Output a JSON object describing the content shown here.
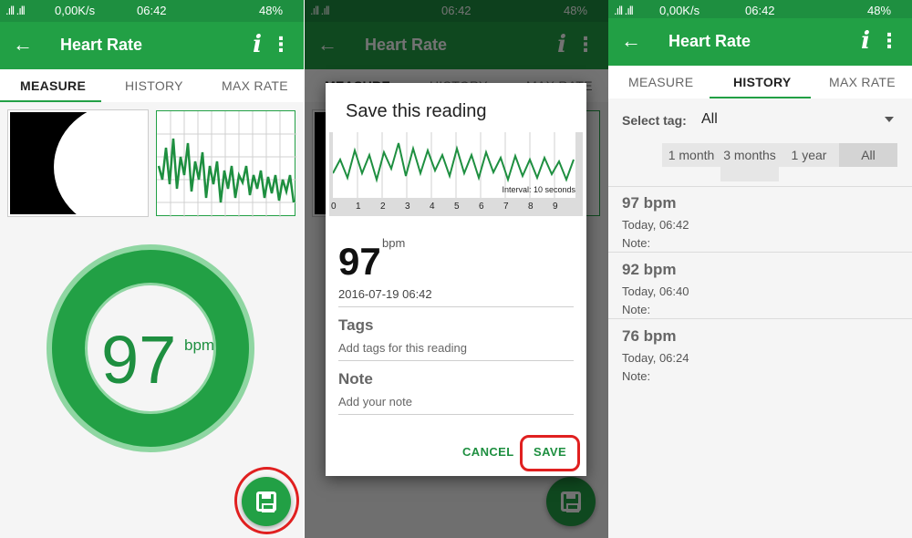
{
  "status": {
    "speed": "0,00K/s",
    "time": "06:42",
    "battery": "48%"
  },
  "app": {
    "title": "Heart Rate",
    "info_glyph": "i",
    "back_icon": "arrow-left-icon",
    "menu_icon": "more-vert-icon"
  },
  "tabs": [
    "MEASURE",
    "HISTORY",
    "MAX RATE"
  ],
  "measure": {
    "value": "97",
    "unit": "bpm"
  },
  "dialog": {
    "title": "Save this reading",
    "interval": "Interval: 10 seconds",
    "ticks": [
      "0",
      "1",
      "2",
      "3",
      "4",
      "5",
      "6",
      "7",
      "8",
      "9"
    ],
    "value": "97",
    "unit": "bpm",
    "datetime": "2016-07-19 06:42",
    "tags_label": "Tags",
    "tags_placeholder": "Add tags for this reading",
    "note_label": "Note",
    "note_placeholder": "Add your note",
    "cancel": "CANCEL",
    "save": "SAVE"
  },
  "history": {
    "select_tag_label": "Select tag:",
    "selected_tag": "All",
    "ranges": [
      "1 month",
      "3 months",
      "1 year",
      "All"
    ],
    "selected_range": "All",
    "entries": [
      {
        "bpm": "97 bpm",
        "when": "Today, 06:42",
        "note": "Note:"
      },
      {
        "bpm": "92 bpm",
        "when": "Today, 06:40",
        "note": "Note:"
      },
      {
        "bpm": "76 bpm",
        "when": "Today, 06:24",
        "note": "Note:"
      }
    ]
  },
  "colors": {
    "primary": "#22a045",
    "primary_dark": "#1e8f40",
    "ring_light": "#8fd6a2",
    "highlight": "#e02020"
  }
}
